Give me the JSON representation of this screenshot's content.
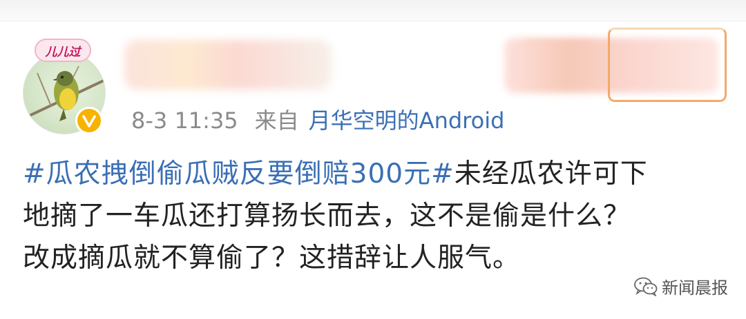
{
  "post": {
    "timestamp": "8-3 11:35",
    "source_prefix": "来自",
    "source_device": "月华空明的Android",
    "hashtag": "#瓜农拽倒偷瓜贼反要倒赔300元#",
    "body_lines": [
      "未经瓜农许可下",
      "地摘了一车瓜还打算扬长而去，这不是偷是什么？",
      "改成摘瓜就不算偷了？这措辞让人服气。"
    ]
  },
  "avatar": {
    "sticker_text": "儿儿过"
  },
  "watermark": {
    "text": "新闻晨报"
  },
  "colors": {
    "link": "#3a6fb5",
    "meta": "#8a8a8a",
    "text": "#222222",
    "verified": "#f6b300"
  },
  "icons": {
    "verified": "verified-v-badge-icon",
    "watermark": "wechat-icon"
  }
}
